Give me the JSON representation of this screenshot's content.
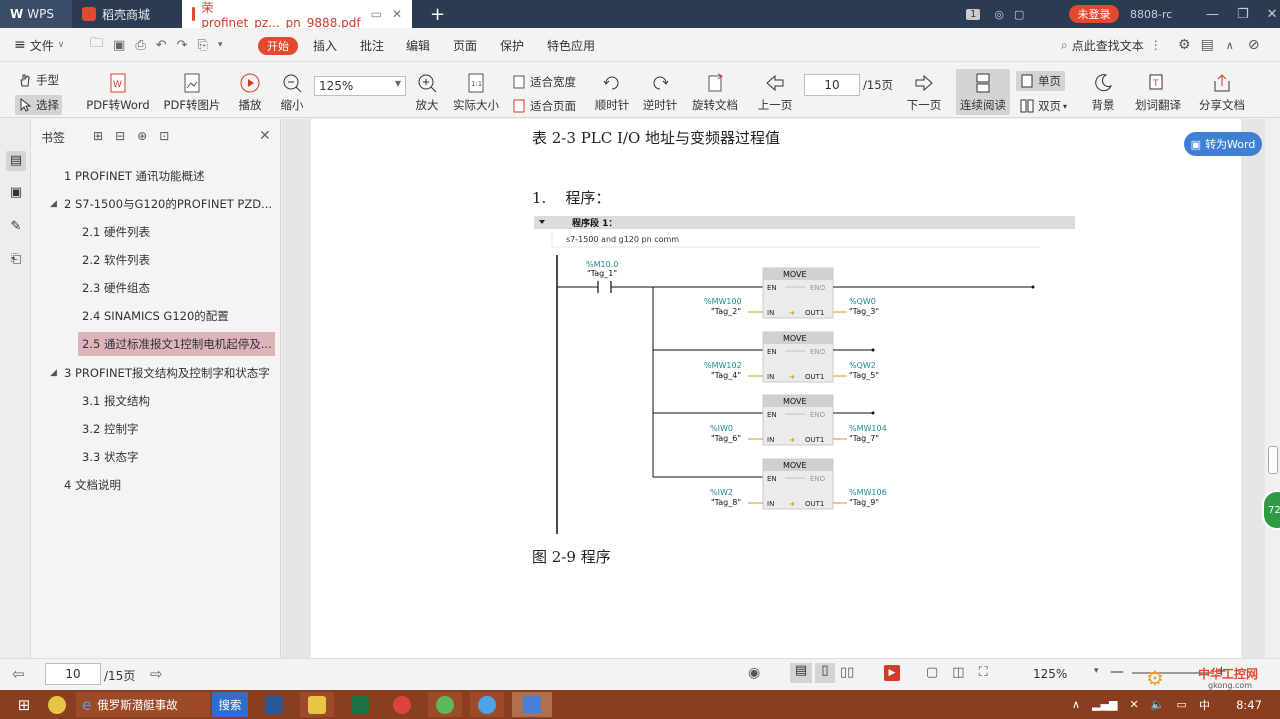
{
  "titlebar": {
    "tabs": [
      {
        "label": "WPS"
      },
      {
        "label": "稻壳商城"
      },
      {
        "label": "荣profinet_pz..._pn_9888.pdf",
        "active": true
      }
    ],
    "add_tab": "+",
    "page_indicator": "1",
    "login": "未登录",
    "user": "8808-rc"
  },
  "menubar": {
    "file": "文件",
    "start": "开始",
    "items": [
      "插入",
      "批注",
      "编辑",
      "页面",
      "保护",
      "特色应用"
    ],
    "search": "点此查找文本"
  },
  "ribbon": {
    "hand": "手型",
    "select": "选择",
    "pdf_to_word": "PDF转Word",
    "pdf_to_image": "PDF转图片",
    "play": "播放",
    "zoom_out": "缩小",
    "zoom_value": "125%",
    "zoom_in": "放大",
    "actual_size": "实际大小",
    "fit_width": "适合宽度",
    "fit_page": "适合页面",
    "rotate_cw": "顺时针",
    "rotate_ccw": "逆时针",
    "rotate_doc": "旋转文档",
    "prev_page": "上一页",
    "page_value": "10",
    "page_total": "/15页",
    "next_page": "下一页",
    "continuous": "连续阅读",
    "single": "单页",
    "double": "双页",
    "background": "背景",
    "translate": "划词翻译",
    "share": "分享文档"
  },
  "bookmarks": {
    "title": "书签",
    "items": [
      {
        "label": "1 PROFINET 通讯功能概述"
      },
      {
        "label": "2 S7-1500与G120的PROFINET  PZD..."
      },
      {
        "label": "2.1 硬件列表"
      },
      {
        "label": "2.2 软件列表"
      },
      {
        "label": "2.3 硬件组态"
      },
      {
        "label": "2.4  SINAMICS G120的配置"
      },
      {
        "label": "2.5 通过标准报文1控制电机起停及..."
      },
      {
        "label": "3  PROFINET报文结构及控制字和状态字"
      },
      {
        "label": "3.1 报文结构"
      },
      {
        "label": "3.2 控制字"
      },
      {
        "label": "3.3 状态字"
      },
      {
        "label": "4 文档说明"
      }
    ]
  },
  "document": {
    "table_caption": "表 2-3 PLC I/O 地址与变频器过程值",
    "section": "1.    程序：",
    "network_title": "程序段 1：",
    "network_comment": "s7-1500 and g120 pn comm",
    "contact_addr": "%M10.0",
    "contact_tag": "\"Tag_1\"",
    "blocks": [
      {
        "name": "MOVE",
        "en": "EN",
        "eno": "ENO",
        "in": "IN",
        "out": "OUT1",
        "in_addr": "%MW100",
        "in_tag": "\"Tag_2\"",
        "out_addr": "%QW0",
        "out_tag": "\"Tag_3\""
      },
      {
        "name": "MOVE",
        "en": "EN",
        "eno": "ENO",
        "in": "IN",
        "out": "OUT1",
        "in_addr": "%MW102",
        "in_tag": "\"Tag_4\"",
        "out_addr": "%QW2",
        "out_tag": "\"Tag_5\""
      },
      {
        "name": "MOVE",
        "en": "EN",
        "eno": "ENO",
        "in": "IN",
        "out": "OUT1",
        "in_addr": "%IW0",
        "in_tag": "\"Tag_6\"",
        "out_addr": "%MW104",
        "out_tag": "\"Tag_7\""
      },
      {
        "name": "MOVE",
        "en": "EN",
        "eno": "ENO",
        "in": "IN",
        "out": "OUT1",
        "in_addr": "%IW2",
        "in_tag": "\"Tag_8\"",
        "out_addr": "%MW106",
        "out_tag": "\"Tag_9\""
      }
    ],
    "figure_caption": "图 2-9 程序",
    "to_word": "转为Word"
  },
  "statusbar": {
    "page_value": "10",
    "page_total": "/15页",
    "zoom": "125%"
  },
  "taskbar": {
    "browser_tab": "俄罗斯潜艇事故",
    "search": "搜索",
    "time": "8:47",
    "ime": "中",
    "watermark": "中华工控网",
    "watermark_url": "gkong.com"
  },
  "float_badge": "72"
}
